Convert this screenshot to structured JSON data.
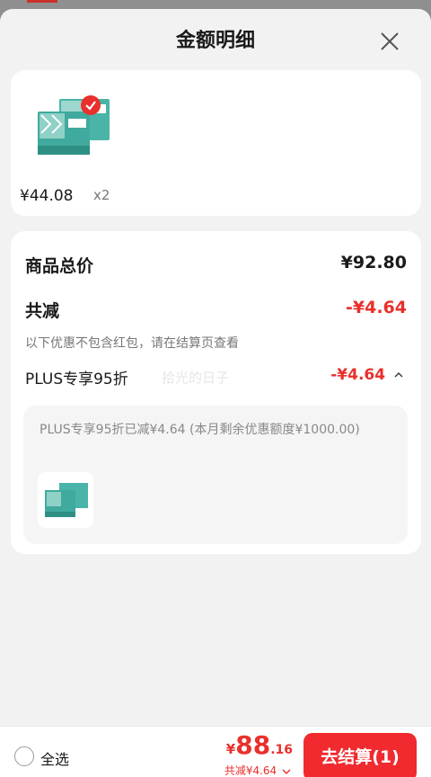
{
  "header": {
    "title": "金额明细"
  },
  "item": {
    "price": "¥44.08",
    "quantity": "x2"
  },
  "summary": {
    "total_label": "商品总价",
    "total_value": "¥92.80",
    "reduction_label": "共减",
    "reduction_value": "-¥4.64",
    "note": "以下优惠不包含红包，请在结算页查看",
    "plus_label": "PLUS专享95折",
    "plus_value": "-¥4.64",
    "watermark": "拾光的日子",
    "detail_text": "PLUS专享95折已减¥4.64 (本月剩余优惠额度¥1000.00)"
  },
  "footer": {
    "select_all": "全选",
    "yen": "¥",
    "total_int": "88",
    "total_dec": ".16",
    "saved_text": "共减¥4.64",
    "checkout_label": "去结算(1)"
  },
  "colors": {
    "accent": "#e8302c",
    "checkout_bg": "#f02a2e"
  },
  "icons": [
    "close-icon",
    "check-badge-icon",
    "chevron-up-icon",
    "chevron-down-icon",
    "radio-unchecked-icon"
  ]
}
